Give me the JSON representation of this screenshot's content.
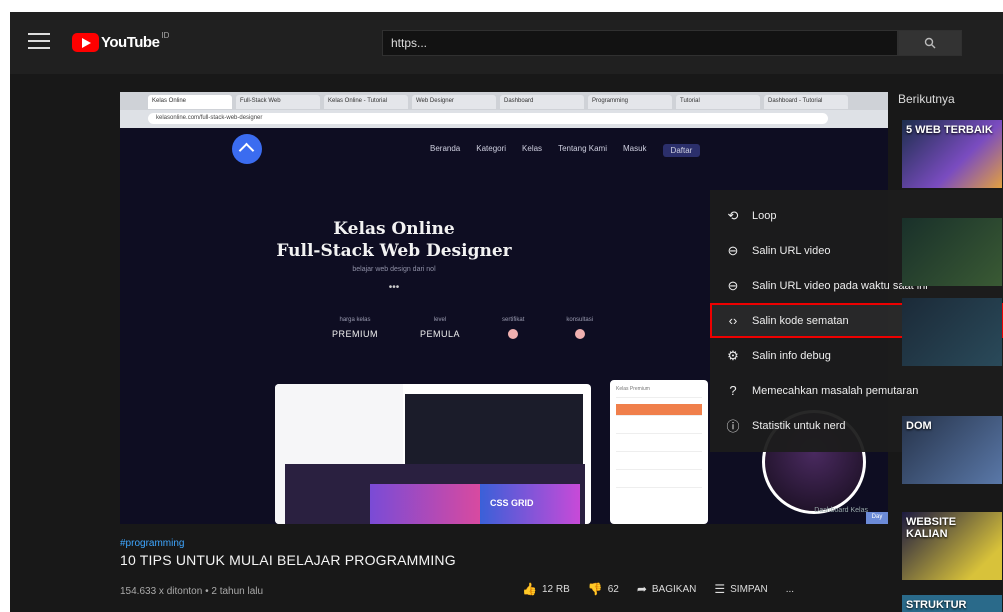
{
  "header": {
    "logo_text": "YouTube",
    "logo_country": "ID",
    "search_value": "https..."
  },
  "player": {
    "browser_tabs": [
      "Kelas Online",
      "Full-Stack Web",
      "Kelas Online - Tutorial",
      "Web Designer",
      "Dashboard",
      "Programming",
      "Tutorial",
      "Dashboard - Tutorial"
    ],
    "browser_url": "kelasonline.com/full-stack-web-designer",
    "site_links": [
      "Beranda",
      "Kategori",
      "Kelas",
      "Tentang Kami",
      "Masuk",
      "Daftar"
    ],
    "hero_title_1": "Kelas Online",
    "hero_title_2": "Full-Stack Web Designer",
    "hero_sub": "belajar web design dari nol",
    "hero_dots": "•••",
    "stats": [
      {
        "label": "harga kelas",
        "value": "PREMIUM"
      },
      {
        "label": "level",
        "value": "PEMULA"
      },
      {
        "label": "sertifikat",
        "value": ""
      },
      {
        "label": "konsultasi",
        "value": ""
      }
    ],
    "mock_panel_title": "Kelas Premium",
    "mock_thumb_text": "CSS GRID",
    "caption": "Dashboard Kelas",
    "badge": "Day"
  },
  "context_menu": {
    "items": [
      {
        "icon": "loop-icon",
        "glyph": "⟲",
        "label": "Loop"
      },
      {
        "icon": "copy-url-icon",
        "glyph": "⊖",
        "label": "Salin URL video"
      },
      {
        "icon": "copy-url-time-icon",
        "glyph": "⊖",
        "label": "Salin URL video pada waktu saat ini"
      },
      {
        "icon": "embed-code-icon",
        "glyph": "‹›",
        "label": "Salin kode sematan"
      },
      {
        "icon": "debug-info-icon",
        "glyph": "⚙",
        "label": "Salin info debug"
      },
      {
        "icon": "troubleshoot-icon",
        "glyph": "?",
        "label": "Memecahkan masalah pemutaran"
      },
      {
        "icon": "stats-info-icon",
        "glyph": "ⓘ",
        "label": "Statistik untuk nerd"
      }
    ]
  },
  "sidebar": {
    "heading": "Berikutnya",
    "thumbs": [
      "5 WEB TERBAIK",
      "",
      "",
      "DOM",
      "WEBSITE KALIAN",
      "STRUKTUR"
    ]
  },
  "video": {
    "hashtag": "#programming",
    "title": "10 TIPS UNTUK MULAI BELAJAR PROGRAMMING",
    "meta": "154.633 x ditonton • 2 tahun lalu",
    "likes": "12 RB",
    "dislikes": "62",
    "share_label": "BAGIKAN",
    "save_label": "SIMPAN",
    "more_label": "..."
  }
}
